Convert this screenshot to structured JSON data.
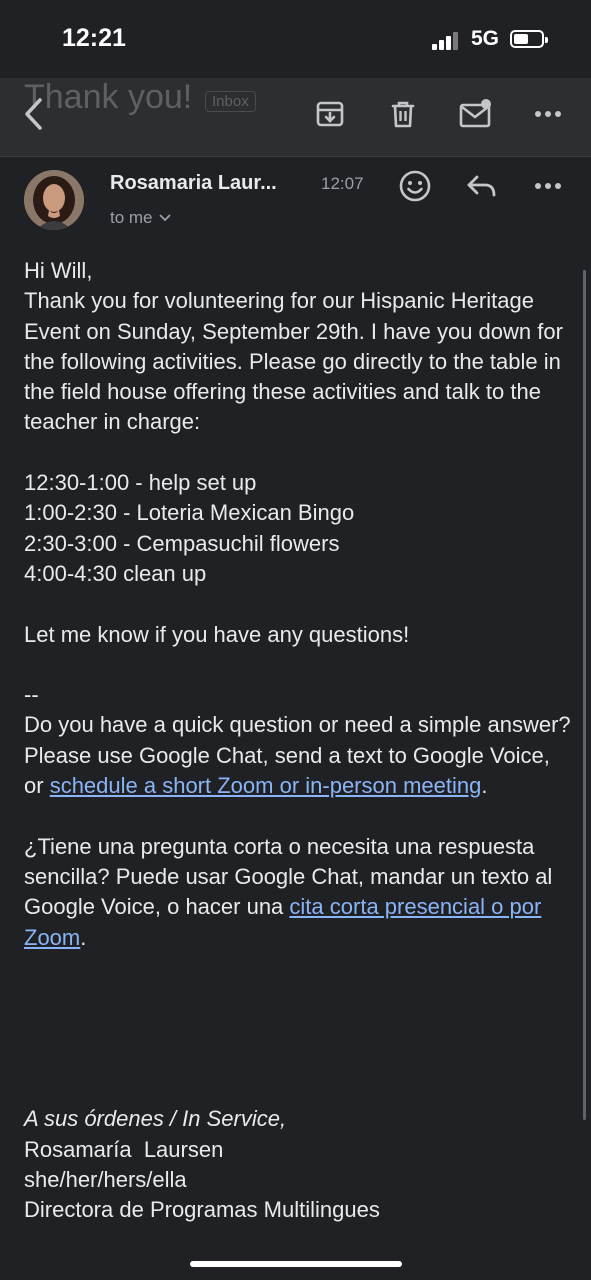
{
  "status_bar": {
    "time": "12:21",
    "network": "5G"
  },
  "toolbar": {
    "ghost_title": "Thank you!",
    "ghost_label": "Inbox",
    "icons": [
      "back-icon",
      "archive-icon",
      "delete-icon",
      "mark-unread-icon",
      "more-icon"
    ]
  },
  "header": {
    "sender": "Rosamaria Laur...",
    "time": "12:07",
    "recipient": "to me"
  },
  "body": {
    "greeting": "Hi Will,",
    "intro": "Thank you for volunteering for our Hispanic Heritage Event on Sunday, September 29th. I have you down for the following activities. Please go directly to the table in the field house offering these activities and talk to the teacher in charge:",
    "schedule": [
      "12:30-1:00 - help set up",
      "1:00-2:30 - Loteria Mexican Bingo",
      "2:30-3:00 - Cempasuchil flowers",
      "4:00-4:30 clean up"
    ],
    "closing_line": "Let me know if you have any questions!",
    "sig_dashes": "--",
    "en_note_text": "Do you have a quick question or need a simple answer? Please use Google Chat, send a text to Google Voice, or ",
    "en_note_link": "schedule a short Zoom or in-person meeting",
    "en_note_end": ".",
    "es_note_text": "¿Tiene una pregunta corta o necesita una respuesta sencilla? Puede usar Google Chat, mandar un texto al Google Voice, o hacer una ",
    "es_note_link": "cita corta presencial o por Zoom",
    "es_note_end": ".",
    "sig_tagline": "A sus órdenes / In Service,",
    "sig_name": "Rosamaría  Laursen",
    "sig_pronouns": "she/her/hers/ella",
    "sig_title": "Directora de Programas Multilingues"
  }
}
